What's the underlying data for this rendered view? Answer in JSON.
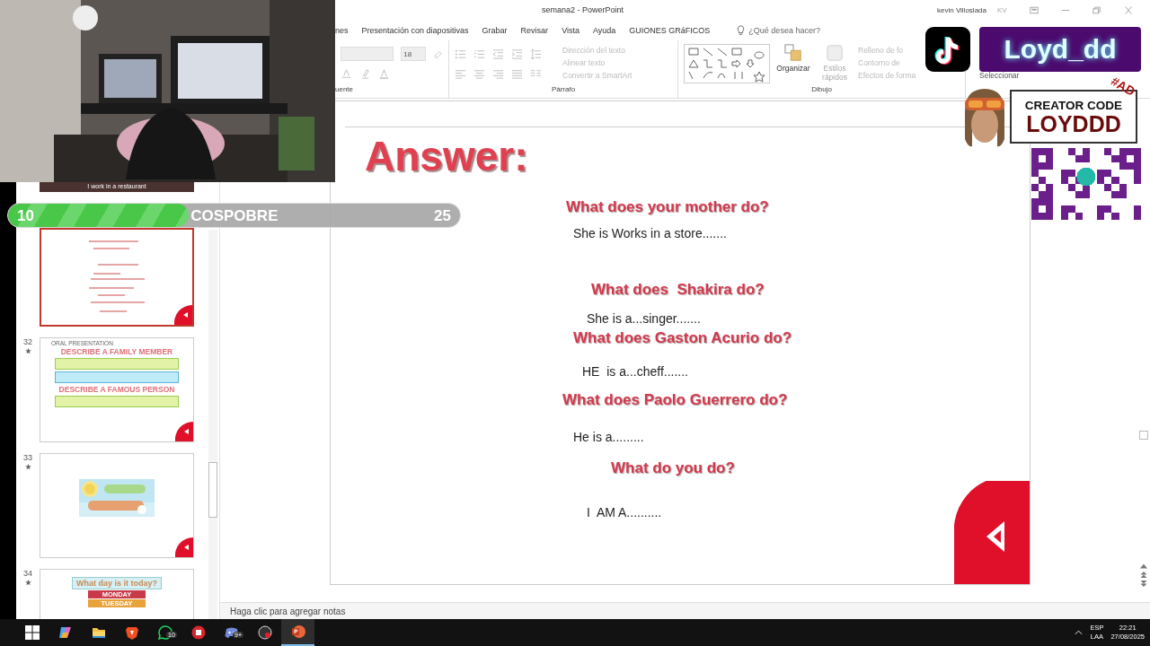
{
  "title_bar": {
    "title": "semana2  -  PowerPoint",
    "user": "kevin Villoslada",
    "initials": "KV"
  },
  "ribbon_tabs": [
    "nes",
    "Presentación con diapositivas",
    "Grabar",
    "Revisar",
    "Vista",
    "Ayuda",
    "GUIONES GRáFICOS"
  ],
  "tell_me": {
    "placeholder": "¿Qué desea hacer?"
  },
  "ribbon": {
    "font_size": "18",
    "groups": [
      "uente",
      "Párrafo",
      "Dibujo"
    ],
    "paragraph_commands": [
      "Dirección del texto",
      "Alinear texto",
      "Convertir a SmartArt"
    ],
    "arrange": "Organizar",
    "quick_styles": "Estilos rápidos",
    "shape_commands": [
      "Relleno de fo",
      "Contorno de",
      "Efectos de forma"
    ],
    "select": "Seleccionar"
  },
  "overlay": {
    "channel": "Loyd_dd",
    "creator_label": "CREATOR CODE",
    "creator_code": "LOYDDD",
    "ad_tag": "#AD",
    "goal": {
      "current": "10",
      "label": "COSPOBRE",
      "target": "25",
      "level": 0.4
    }
  },
  "slides_panel": {
    "previous_caption": "I work in a restaurant",
    "slides": [
      {
        "kind": "answers",
        "selected": true
      },
      {
        "number": "32",
        "kind": "oral",
        "selected": false,
        "heading": "ORAL PRESENTATION",
        "titles": [
          "DESCRIBE A FAMILY MEMBER",
          "DESCRIBE A FAMOUS PERSON"
        ]
      },
      {
        "number": "33",
        "kind": "days",
        "selected": false
      },
      {
        "number": "34",
        "kind": "today",
        "selected": false,
        "title": "What day is it today?",
        "days": [
          {
            "text": "MONDAY",
            "color": "#c8394a"
          },
          {
            "text": "TUESDAY",
            "color": "#e8a23a"
          }
        ]
      }
    ]
  },
  "slide": {
    "title": "Answer:",
    "lines": [
      {
        "kind": "question",
        "text": "What does your mother do?"
      },
      {
        "kind": "answer",
        "text": "She is Works in a store......."
      },
      {
        "kind": "question",
        "text": "What does  Shakira do?"
      },
      {
        "kind": "answer",
        "text": "She is a...singer......."
      },
      {
        "kind": "question",
        "text": "What does Gaston Acurio do?"
      },
      {
        "kind": "answer",
        "text": "HE  is a...cheff......."
      },
      {
        "kind": "question",
        "text": "What does Paolo Guerrero do?"
      },
      {
        "kind": "answer",
        "text": "He is a........."
      },
      {
        "kind": "question",
        "text": "What do you do?"
      },
      {
        "kind": "answer",
        "text": "I  AM A.........."
      }
    ]
  },
  "notes": {
    "placeholder": "Haga clic para agregar notas"
  },
  "taskbar": {
    "apps": [
      {
        "kind": "start",
        "selected": false
      },
      {
        "kind": "copilot",
        "selected": false
      },
      {
        "kind": "explorer",
        "selected": false
      },
      {
        "kind": "brave",
        "selected": false
      },
      {
        "kind": "whatsapp",
        "selected": false,
        "badge": "10"
      },
      {
        "kind": "office",
        "selected": false
      },
      {
        "kind": "discord",
        "selected": false,
        "badge": "9+"
      },
      {
        "kind": "recorder",
        "selected": false
      },
      {
        "kind": "powerpoint",
        "selected": true
      }
    ],
    "tray": {
      "language": "ESP",
      "layout": "LAA",
      "time": "22:21",
      "date": "27/08/2025"
    }
  }
}
